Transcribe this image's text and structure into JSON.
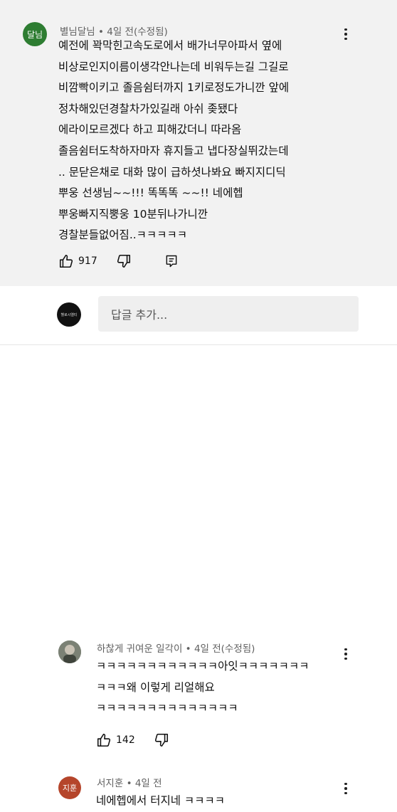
{
  "comments": [
    {
      "avatar_text": "달님",
      "avatar_color": "#2e7d32",
      "author": "별님달님",
      "time": "4일 전(수정됨)",
      "lines": [
        "예전에 꽉막힌고속도로에서 배가너무아파서 옆에",
        "비상로인지이름이생각안나는데 비워두는길 그길로",
        "비깜빡이키고 졸음쉼터까지 1키로정도가니깐 앞에",
        "정차해있던경찰차가있길래 아쉬 좆됐다",
        "에라이모르겠다 하고 피해갔더니 따라옴",
        "졸음쉼터도착하자마자 휴지들고 냅다장실뛰갔는데",
        ".. 문닫은채로 대화 많이 급하셧나봐요 빠지지디딕",
        "뿌웅 선생님~~!!! 똑똑똑 ~~!! 네에헵",
        "뿌웅빠지직뿡웅 10분뒤나가니깐",
        "경찰분들없어짐..ㅋㅋㅋㅋㅋ"
      ],
      "likes": "917"
    },
    {
      "author": "하찮게 귀여운 일각이",
      "time": "4일 전(수정됨)",
      "lines": [
        "ㅋㅋㅋㅋㅋㅋㅋㅋㅋㅋㅋㅋ아잇ㅋㅋㅋㅋㅋㅋㅋ",
        "ㅋㅋㅋ왜 이렇게 리얼해요",
        "ㅋㅋㅋㅋㅋㅋㅋㅋㅋㅋㅋㅋㅋㅋ"
      ],
      "likes": "142"
    },
    {
      "avatar_text": "지훈",
      "avatar_color": "#b5452b",
      "author": "서지훈",
      "time": "4일 전",
      "lines": [
        "네에헵에서 터지네 ㅋㅋㅋㅋ"
      ]
    }
  ],
  "reply_box": {
    "avatar_text": "헬로시엘티",
    "placeholder": "답글 추가..."
  },
  "colors": {
    "highlight_bg": "#f2f2f2",
    "meta_text": "#606060"
  },
  "icons": [
    "thumbs-up-icon",
    "thumbs-down-icon",
    "reply-icon",
    "more-vert-icon"
  ]
}
